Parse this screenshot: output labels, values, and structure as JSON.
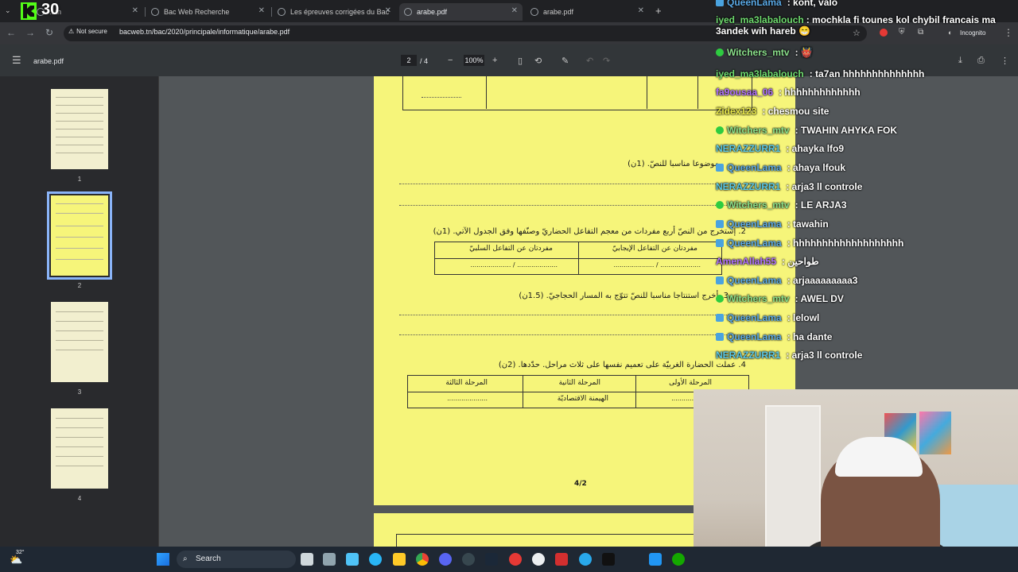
{
  "overlay": {
    "kick_count": "30"
  },
  "tabs": [
    {
      "label": "...tn"
    },
    {
      "label": "Bac Web Recherche"
    },
    {
      "label": "Les épreuves corrigées du Bac"
    },
    {
      "label": "arabe.pdf"
    },
    {
      "label": "arabe.pdf"
    }
  ],
  "new_tab_label": "+",
  "address": {
    "security": "Not secure",
    "url": "bacweb.tn/bac/2020/principale/informatique/arabe.pdf",
    "incognito": "Incognito"
  },
  "pdf_toolbar": {
    "title": "arabe.pdf",
    "current_page": "2",
    "total_pages": "/ 4",
    "zoom": "100%"
  },
  "thumbnails": [
    {
      "num": "1"
    },
    {
      "num": "2"
    },
    {
      "num": "3"
    },
    {
      "num": "4"
    }
  ],
  "pdf_content": {
    "q1": "موضوعا مناسبا للنصّ. (1ن)",
    "q2": "2. إستخرج من النصّ أربع مفردات من معجم التفاعل الحضاريّ وصنّفها وفق الجدول الآتي. (1ن)",
    "table1_col_positive": "مفردتان عن التفاعل الإيجابيّ",
    "table1_col_negative": "مفردتان عن التفاعل السلبيّ",
    "table1_row": "....................  /  ....................",
    "q3": "3. أخرج استنتاجا مناسبا للنصّ تتوّج به المسار الحجاجيّ. (1.5ن)",
    "q4": "4. عملت الحضارة الغربيّة على تعميم نفسها على ثلاث مراحل. حدّدها. (2ن)",
    "table2_first": "المرحلة الأولى",
    "table2_second": "المرحلة الثانية",
    "table2_third": "المرحلة الثالثة",
    "table2_second_value": "الهيمنة الاقتصاديّة",
    "table2_dots": "....................",
    "page_number": "4/2"
  },
  "chat": [
    {
      "user": "QueenLama",
      "text": ": kont, valo",
      "user_color": "#5aa9e6"
    },
    {
      "user": "iyed_ma3labalouch",
      "text": ": mochkla fi tounes kol chybil francais ma 3andek wih hareb 😁",
      "user_color": "#6fdc6f"
    },
    {
      "user": "Witchers_mtv",
      "text": ": 👹",
      "user_color": "#8be08b"
    },
    {
      "user": "iyed_ma3labalouch",
      "text": ": ta7an hhhhhhhhhhhhhh",
      "user_color": "#6fdc6f"
    },
    {
      "user": "fa9ousaa_06",
      "text": ": hhhhhhhhhhhhh",
      "user_color": "#b070ff"
    },
    {
      "user": "Zidex123",
      "text": ": chesmou site",
      "user_color": "#e8e84a"
    },
    {
      "user": "Witchers_mtv",
      "text": ": TWAHIN AHYKA FOK",
      "user_color": "#8be08b"
    },
    {
      "user": "NERAZZURR1",
      "text": ": ahayka lfo9",
      "user_color": "#5ac8e6"
    },
    {
      "user": "QueenLama",
      "text": ": ahaya lfouk",
      "user_color": "#5aa9e6"
    },
    {
      "user": "NERAZZURR1",
      "text": ": arja3 ll controle",
      "user_color": "#5ac8e6"
    },
    {
      "user": "Witchers_mtv",
      "text": ": LE ARJA3",
      "user_color": "#8be08b"
    },
    {
      "user": "QueenLama",
      "text": ": tawahin",
      "user_color": "#5aa9e6"
    },
    {
      "user": "QueenLama",
      "text": ": hhhhhhhhhhhhhhhhhhh",
      "user_color": "#5aa9e6"
    },
    {
      "user": "AmenAllah55",
      "text": ": طواحين",
      "user_color": "#b070ff"
    },
    {
      "user": "QueenLama",
      "text": ": arjaaaaaaaaa3",
      "user_color": "#5aa9e6"
    },
    {
      "user": "Witchers_mtv",
      "text": ": AWEL DV",
      "user_color": "#8be08b"
    },
    {
      "user": "QueenLama",
      "text": ": lelowl",
      "user_color": "#5aa9e6"
    },
    {
      "user": "QueenLama",
      "text": ": ha dante",
      "user_color": "#5aa9e6"
    },
    {
      "user": "NERAZZURR1",
      "text": ": arja3 ll controle",
      "user_color": "#5ac8e6"
    }
  ],
  "taskbar": {
    "weather": "32°",
    "search_placeholder": "Search"
  }
}
